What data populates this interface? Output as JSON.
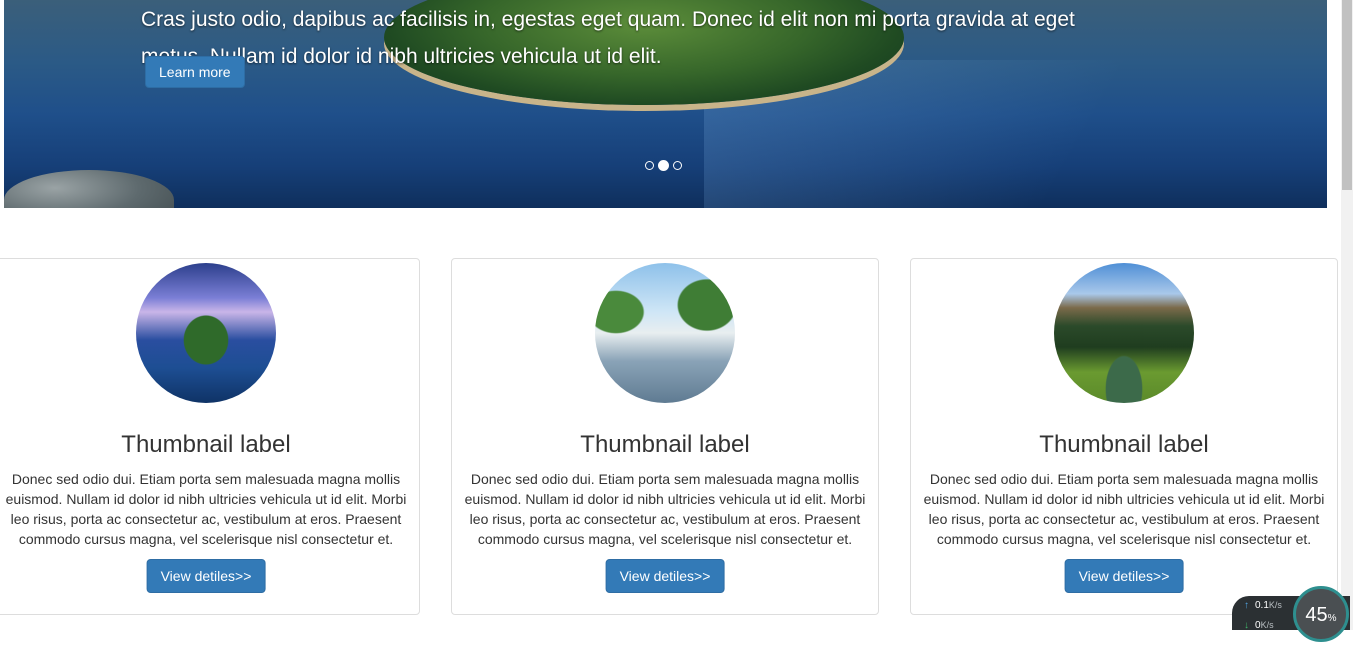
{
  "carousel": {
    "caption": "Cras justo odio, dapibus ac facilisis in, egestas eget quam. Donec id elit non mi porta gravida at eget metus. Nullam id dolor id nibh ultricies vehicula ut id elit.",
    "button_label": "Learn more",
    "indicators": 3,
    "active_indicator": 2
  },
  "thumbnails": [
    {
      "title": "Thumbnail label",
      "text": "Donec sed odio dui. Etiam porta sem malesuada magna mollis euismod. Nullam id dolor id nibh ultricies vehicula ut id elit. Morbi leo risus, porta ac consectetur ac, vestibulum at eros. Praesent commodo cursus magna, vel scelerisque nisl consectetur et.",
      "button_label": "View detiles>>",
      "image": "island"
    },
    {
      "title": "Thumbnail label",
      "text": "Donec sed odio dui. Etiam porta sem malesuada magna mollis euismod. Nullam id dolor id nibh ultricies vehicula ut id elit. Morbi leo risus, porta ac consectetur ac, vestibulum at eros. Praesent commodo cursus magna, vel scelerisque nisl consectetur et.",
      "button_label": "View detiles>>",
      "image": "canal"
    },
    {
      "title": "Thumbnail label",
      "text": "Donec sed odio dui. Etiam porta sem malesuada magna mollis euismod. Nullam id dolor id nibh ultricies vehicula ut id elit. Morbi leo risus, porta ac consectetur ac, vestibulum at eros. Praesent commodo cursus magna, vel scelerisque nisl consectetur et.",
      "button_label": "View detiles>>",
      "image": "mountain"
    }
  ],
  "net_widget": {
    "upload_value": "0.1",
    "upload_unit": "K/s",
    "download_value": "0",
    "download_unit": "K/s",
    "gauge_value": "45",
    "gauge_unit": "%"
  },
  "colors": {
    "primary_button": "#337ab7",
    "border": "#dddddd"
  }
}
